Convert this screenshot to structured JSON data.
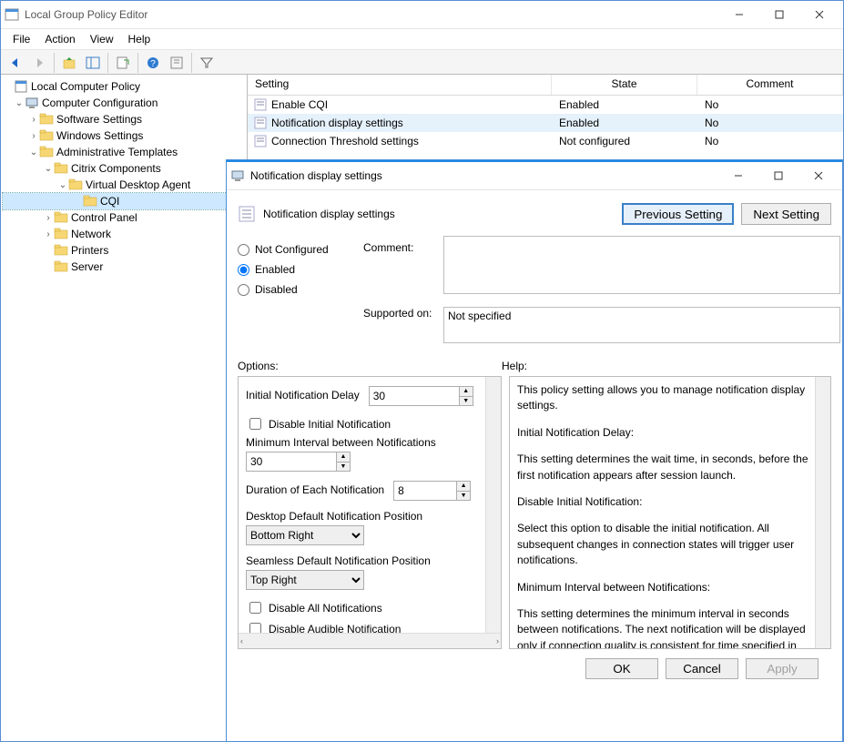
{
  "main_window": {
    "title": "Local Group Policy Editor",
    "menubar": [
      "File",
      "Action",
      "View",
      "Help"
    ]
  },
  "tree": {
    "root": "Local Computer Policy",
    "computer_config": "Computer Configuration",
    "software": "Software Settings",
    "windows": "Windows Settings",
    "admin": "Administrative Templates",
    "citrix": "Citrix Components",
    "vda": "Virtual Desktop Agent",
    "cqi": "CQI",
    "control_panel": "Control Panel",
    "network": "Network",
    "printers": "Printers",
    "server": "Server"
  },
  "list": {
    "headers": {
      "setting": "Setting",
      "state": "State",
      "comment": "Comment"
    },
    "rows": [
      {
        "setting": "Enable CQI",
        "state": "Enabled",
        "comment": "No"
      },
      {
        "setting": "Notification display settings",
        "state": "Enabled",
        "comment": "No"
      },
      {
        "setting": "Connection Threshold settings",
        "state": "Not configured",
        "comment": "No"
      }
    ]
  },
  "dialog": {
    "title": "Notification display settings",
    "heading": "Notification display settings",
    "prev": "Previous Setting",
    "next": "Next Setting",
    "radios": {
      "not_configured": "Not Configured",
      "enabled": "Enabled",
      "disabled": "Disabled"
    },
    "comment_label": "Comment:",
    "comment_value": "",
    "supported_label": "Supported on:",
    "supported_value": "Not specified",
    "options_label": "Options:",
    "help_label": "Help:",
    "options": {
      "initial_delay_label": "Initial Notification Delay",
      "initial_delay_value": "30",
      "disable_initial": "Disable Initial Notification",
      "min_interval_label": "Minimum Interval between Notifications",
      "min_interval_value": "30",
      "duration_label": "Duration of Each Notification",
      "duration_value": "8",
      "desktop_pos_label": "Desktop Default Notification Position",
      "desktop_pos_value": "Bottom Right",
      "seamless_pos_label": "Seamless Default Notification Position",
      "seamless_pos_value": "Top Right",
      "disable_all": "Disable All Notifications",
      "disable_audible": "Disable Audible Notification"
    },
    "help_text": {
      "p1": "This policy setting allows you to manage notification display settings.",
      "p2": "Initial Notification Delay:",
      "p3": "This setting determines the wait time, in seconds, before the first notification appears after session launch.",
      "p4": "Disable Initial Notification:",
      "p5": "Select this option to disable the initial notification. All subsequent changes in connection states will trigger user notifications.",
      "p6": "Minimum Interval between Notifications:",
      "p7": "This setting determines the minimum interval in seconds between notifications. The next notification will be displayed only if connection quality is consistent for time specified in this value."
    },
    "buttons": {
      "ok": "OK",
      "cancel": "Cancel",
      "apply": "Apply"
    }
  }
}
